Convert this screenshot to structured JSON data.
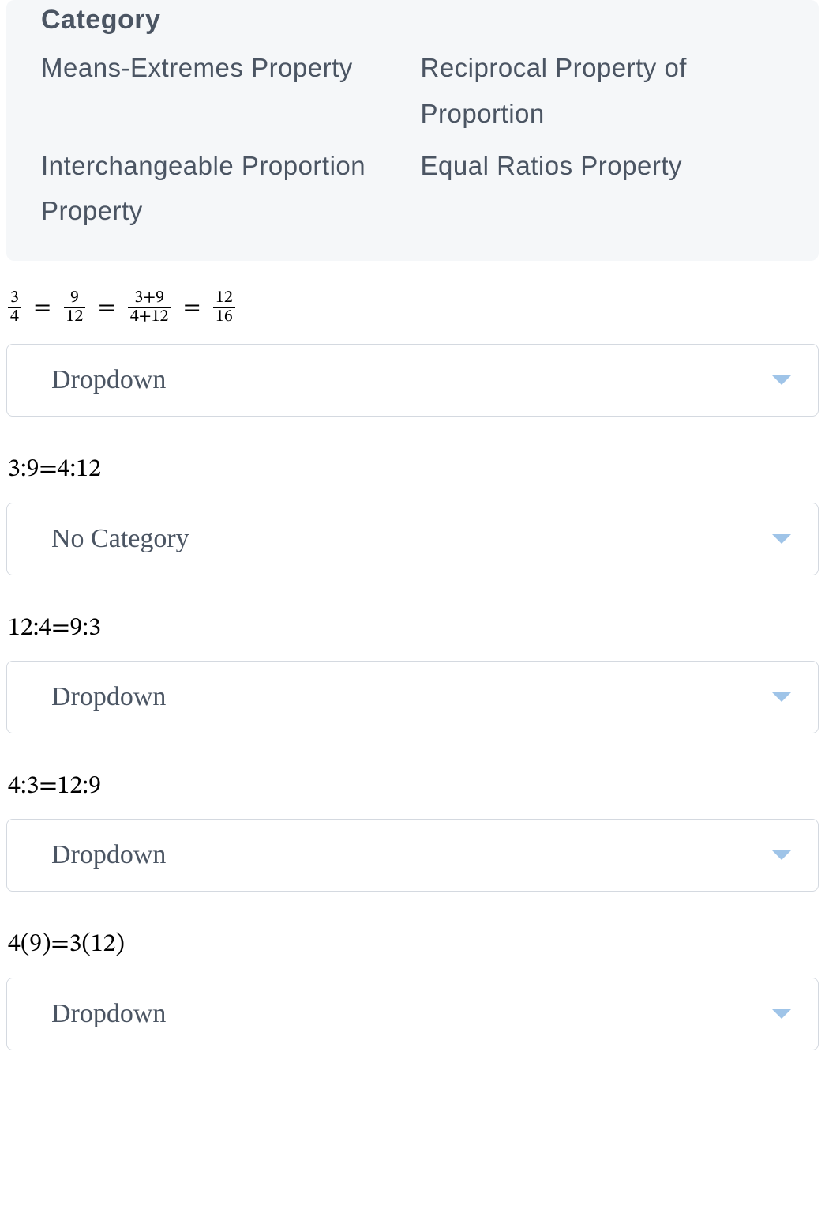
{
  "categoryPanel": {
    "header": "Category",
    "items": [
      "Means-Extremes Property",
      "Reciprocal Property of Proportion",
      "Interchangeable Proportion Property",
      "Equal Ratios Property"
    ]
  },
  "questions": [
    {
      "type": "fraction_chain",
      "chain": [
        {
          "num": "3",
          "den": "4"
        },
        {
          "num": "9",
          "den": "12"
        },
        {
          "num": "3+9",
          "den": "4+12"
        },
        {
          "num": "12",
          "den": "16"
        }
      ],
      "dropdown": "Dropdown"
    },
    {
      "type": "text",
      "expr": "3:9=4:12",
      "dropdown": "No Category"
    },
    {
      "type": "text",
      "expr": "12:4=9:3",
      "dropdown": "Dropdown"
    },
    {
      "type": "text",
      "expr": "4:3=12:9",
      "dropdown": "Dropdown"
    },
    {
      "type": "text",
      "expr": "4(9)=3(12)",
      "dropdown": "Dropdown"
    }
  ]
}
